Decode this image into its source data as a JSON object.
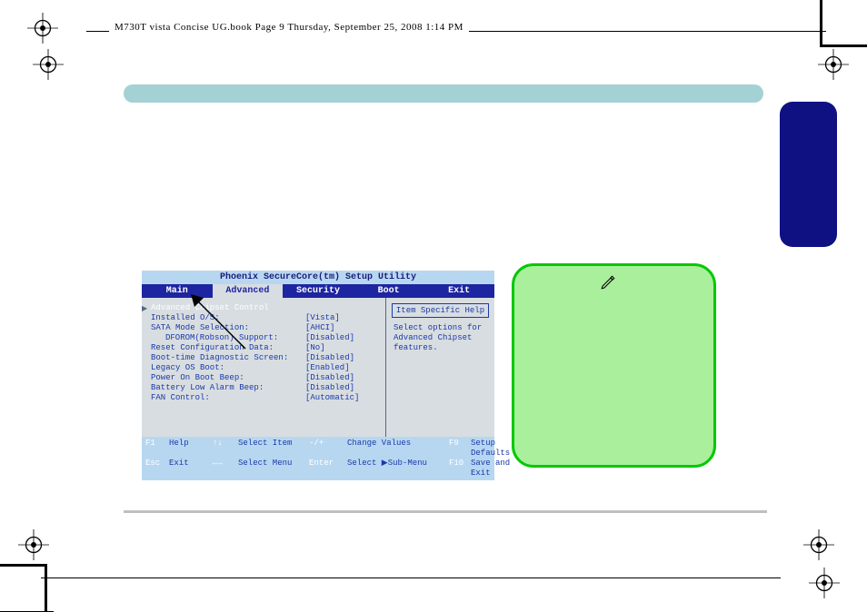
{
  "header": {
    "text": "M730T vista Concise UG.book  Page 9  Thursday, September 25, 2008  1:14 PM"
  },
  "bios": {
    "title": "Phoenix SecureCore(tm) Setup Utility",
    "tabs": {
      "main": "Main",
      "advanced": "Advanced",
      "security": "Security",
      "boot": "Boot",
      "exit": "Exit"
    },
    "section": "Advanced Chipset Control",
    "rows": {
      "installed_os": {
        "label": "Installed O/S:",
        "value": "[Vista]"
      },
      "sata_mode": {
        "label": "SATA Mode Selection:",
        "value": "[AHCI]"
      },
      "dforom": {
        "label": "DFOROM(Robson) Support:",
        "value": "[Disabled]"
      },
      "reset_cfg": {
        "label": "Reset Configuration Data:",
        "value": "[No]"
      },
      "boot_diag": {
        "label": "Boot-time Diagnostic Screen:",
        "value": "[Disabled]"
      },
      "legacy_usb": {
        "label": "Legacy OS Boot:",
        "value": "[Enabled]"
      },
      "power_beep": {
        "label": "Power On Boot Beep:",
        "value": "[Disabled]"
      },
      "batt_low": {
        "label": "Battery Low Alarm Beep:",
        "value": "[Disabled]"
      },
      "fan": {
        "label": "FAN Control:",
        "value": "[Automatic]"
      }
    },
    "help": {
      "title": "Item Specific Help",
      "line1": "Select options for",
      "line2": "Advanced Chipset",
      "line3": "features."
    },
    "foot": {
      "f1": "F1",
      "help": "Help",
      "arrows_ud": "↑↓",
      "sel_item": "Select Item",
      "pm": "-/+",
      "chg": "Change Values",
      "f9": "F9",
      "defaults": "Setup Defaults",
      "esc": "Esc",
      "exit": "Exit",
      "arrows_lr": "←→",
      "sel_menu": "Select Menu",
      "enter": "Enter",
      "sub": "Select ▶Sub-Menu",
      "f10": "F10",
      "save": "Save and Exit"
    }
  }
}
